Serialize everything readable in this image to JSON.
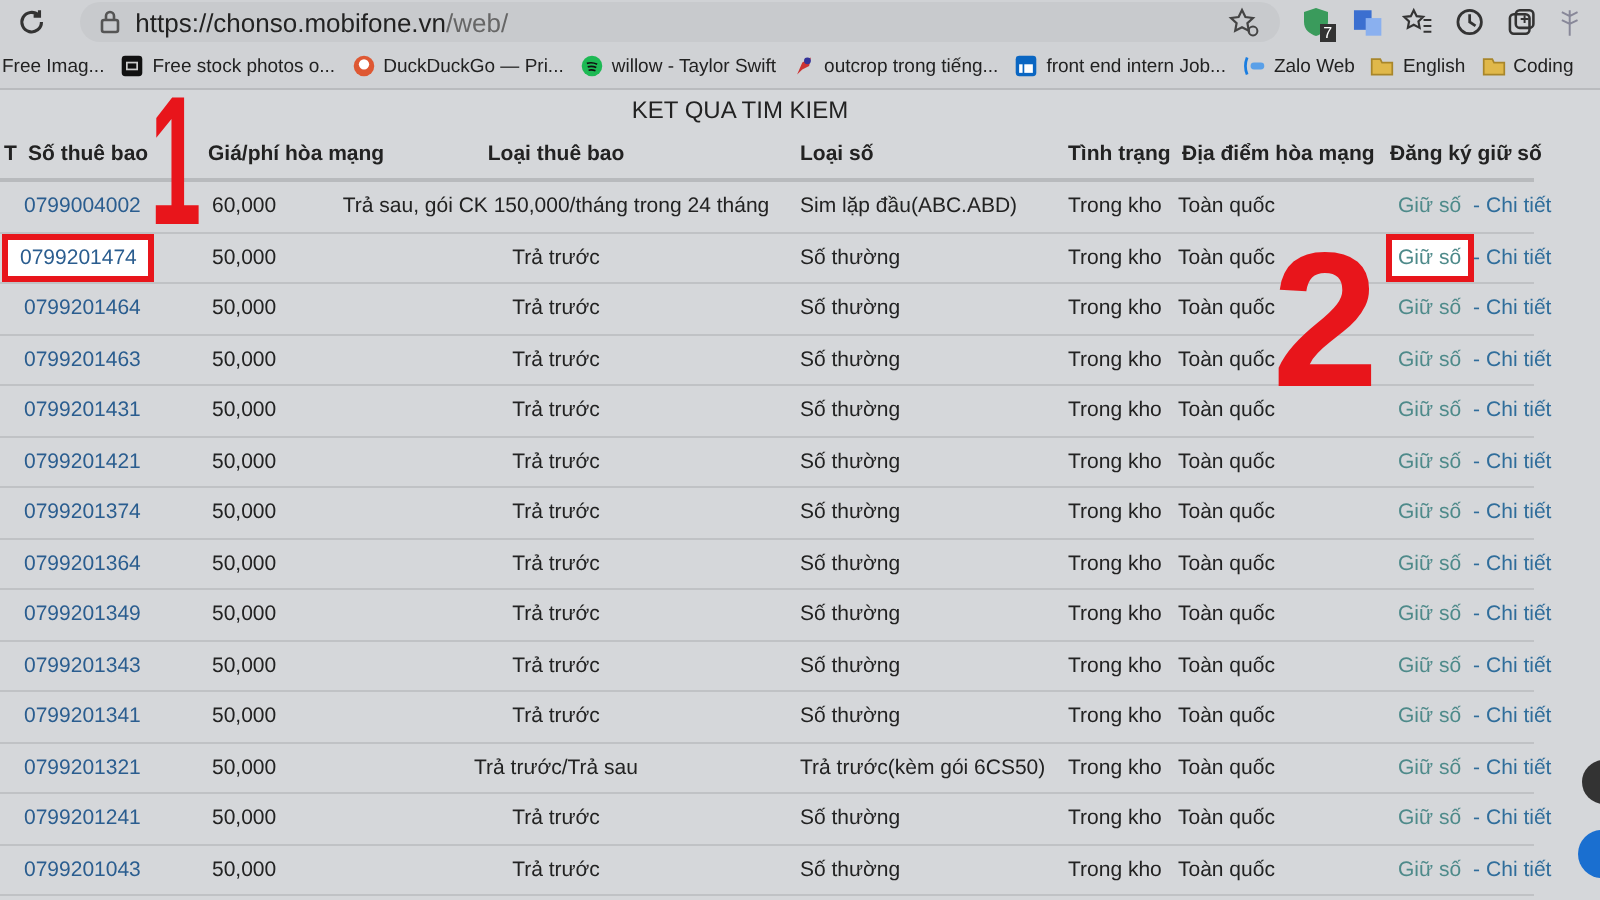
{
  "browser": {
    "url_host": "https://chonso.mobifone.vn",
    "url_path": "/web/",
    "extension_badge": "7"
  },
  "bookmarks": [
    {
      "label": "Free Imag...",
      "kind": "none"
    },
    {
      "label": "Free stock photos o...",
      "kind": "square"
    },
    {
      "label": "DuckDuckGo — Pri...",
      "kind": "duck"
    },
    {
      "label": "willow - Taylor Swift",
      "kind": "spotify"
    },
    {
      "label": "outcrop trong tiếng...",
      "kind": "bird"
    },
    {
      "label": "front end intern Job...",
      "kind": "linkedin"
    },
    {
      "label": "Zalo Web",
      "kind": "zalo"
    },
    {
      "label": "English",
      "kind": "folder"
    },
    {
      "label": "Coding",
      "kind": "folder"
    }
  ],
  "page": {
    "title": "KET QUA TIM KIEM",
    "columns": [
      "T",
      "Số thuê bao",
      "Giá/phí hòa mạng",
      "Loại thuê bao",
      "Loại số",
      "Tình trạng",
      "Địa điểm hòa mạng",
      "Đăng ký giữ số"
    ],
    "rows": [
      {
        "number": "0799004002",
        "price": "60,000",
        "subscription": "Trả sau, gói CK 150,000/tháng trong 24 tháng",
        "number_type": "Sim lặp đầu(ABC.ABD)",
        "status": "Trong kho",
        "location": "Toàn quốc",
        "hold": "Giữ số",
        "separator": "-",
        "detail": "Chi tiết",
        "number_highlighted": false,
        "hold_highlighted": false
      },
      {
        "number": "0799201474",
        "price": "50,000",
        "subscription": "Trả trước",
        "number_type": "Số thường",
        "status": "Trong kho",
        "location": "Toàn quốc",
        "hold": "Giữ số",
        "separator": "-",
        "detail": "Chi tiết",
        "number_highlighted": true,
        "hold_highlighted": true
      },
      {
        "number": "0799201464",
        "price": "50,000",
        "subscription": "Trả trước",
        "number_type": "Số thường",
        "status": "Trong kho",
        "location": "Toàn quốc",
        "hold": "Giữ số",
        "separator": "-",
        "detail": "Chi tiết",
        "number_highlighted": false,
        "hold_highlighted": false
      },
      {
        "number": "0799201463",
        "price": "50,000",
        "subscription": "Trả trước",
        "number_type": "Số thường",
        "status": "Trong kho",
        "location": "Toàn quốc",
        "hold": "Giữ số",
        "separator": "-",
        "detail": "Chi tiết",
        "number_highlighted": false,
        "hold_highlighted": false
      },
      {
        "number": "0799201431",
        "price": "50,000",
        "subscription": "Trả trước",
        "number_type": "Số thường",
        "status": "Trong kho",
        "location": "Toàn quốc",
        "hold": "Giữ số",
        "separator": "-",
        "detail": "Chi tiết",
        "number_highlighted": false,
        "hold_highlighted": false
      },
      {
        "number": "0799201421",
        "price": "50,000",
        "subscription": "Trả trước",
        "number_type": "Số thường",
        "status": "Trong kho",
        "location": "Toàn quốc",
        "hold": "Giữ số",
        "separator": "-",
        "detail": "Chi tiết",
        "number_highlighted": false,
        "hold_highlighted": false
      },
      {
        "number": "0799201374",
        "price": "50,000",
        "subscription": "Trả trước",
        "number_type": "Số thường",
        "status": "Trong kho",
        "location": "Toàn quốc",
        "hold": "Giữ số",
        "separator": "-",
        "detail": "Chi tiết",
        "number_highlighted": false,
        "hold_highlighted": false
      },
      {
        "number": "0799201364",
        "price": "50,000",
        "subscription": "Trả trước",
        "number_type": "Số thường",
        "status": "Trong kho",
        "location": "Toàn quốc",
        "hold": "Giữ số",
        "separator": "-",
        "detail": "Chi tiết",
        "number_highlighted": false,
        "hold_highlighted": false
      },
      {
        "number": "0799201349",
        "price": "50,000",
        "subscription": "Trả trước",
        "number_type": "Số thường",
        "status": "Trong kho",
        "location": "Toàn quốc",
        "hold": "Giữ số",
        "separator": "-",
        "detail": "Chi tiết",
        "number_highlighted": false,
        "hold_highlighted": false
      },
      {
        "number": "0799201343",
        "price": "50,000",
        "subscription": "Trả trước",
        "number_type": "Số thường",
        "status": "Trong kho",
        "location": "Toàn quốc",
        "hold": "Giữ số",
        "separator": "-",
        "detail": "Chi tiết",
        "number_highlighted": false,
        "hold_highlighted": false
      },
      {
        "number": "0799201341",
        "price": "50,000",
        "subscription": "Trả trước",
        "number_type": "Số thường",
        "status": "Trong kho",
        "location": "Toàn quốc",
        "hold": "Giữ số",
        "separator": "-",
        "detail": "Chi tiết",
        "number_highlighted": false,
        "hold_highlighted": false
      },
      {
        "number": "0799201321",
        "price": "50,000",
        "subscription": "Trả trước/Trả sau",
        "number_type": "Trả trước(kèm gói 6CS50)",
        "status": "Trong kho",
        "location": "Toàn quốc",
        "hold": "Giữ số",
        "separator": "-",
        "detail": "Chi tiết",
        "number_highlighted": false,
        "hold_highlighted": false
      },
      {
        "number": "0799201241",
        "price": "50,000",
        "subscription": "Trả trước",
        "number_type": "Số thường",
        "status": "Trong kho",
        "location": "Toàn quốc",
        "hold": "Giữ số",
        "separator": "-",
        "detail": "Chi tiết",
        "number_highlighted": false,
        "hold_highlighted": false
      },
      {
        "number": "0799201043",
        "price": "50,000",
        "subscription": "Trả trước",
        "number_type": "Số thường",
        "status": "Trong kho",
        "location": "Toàn quốc",
        "hold": "Giữ số",
        "separator": "-",
        "detail": "Chi tiết",
        "number_highlighted": false,
        "hold_highlighted": false
      }
    ]
  },
  "callouts": [
    {
      "label": "1"
    },
    {
      "label": "2"
    }
  ]
}
